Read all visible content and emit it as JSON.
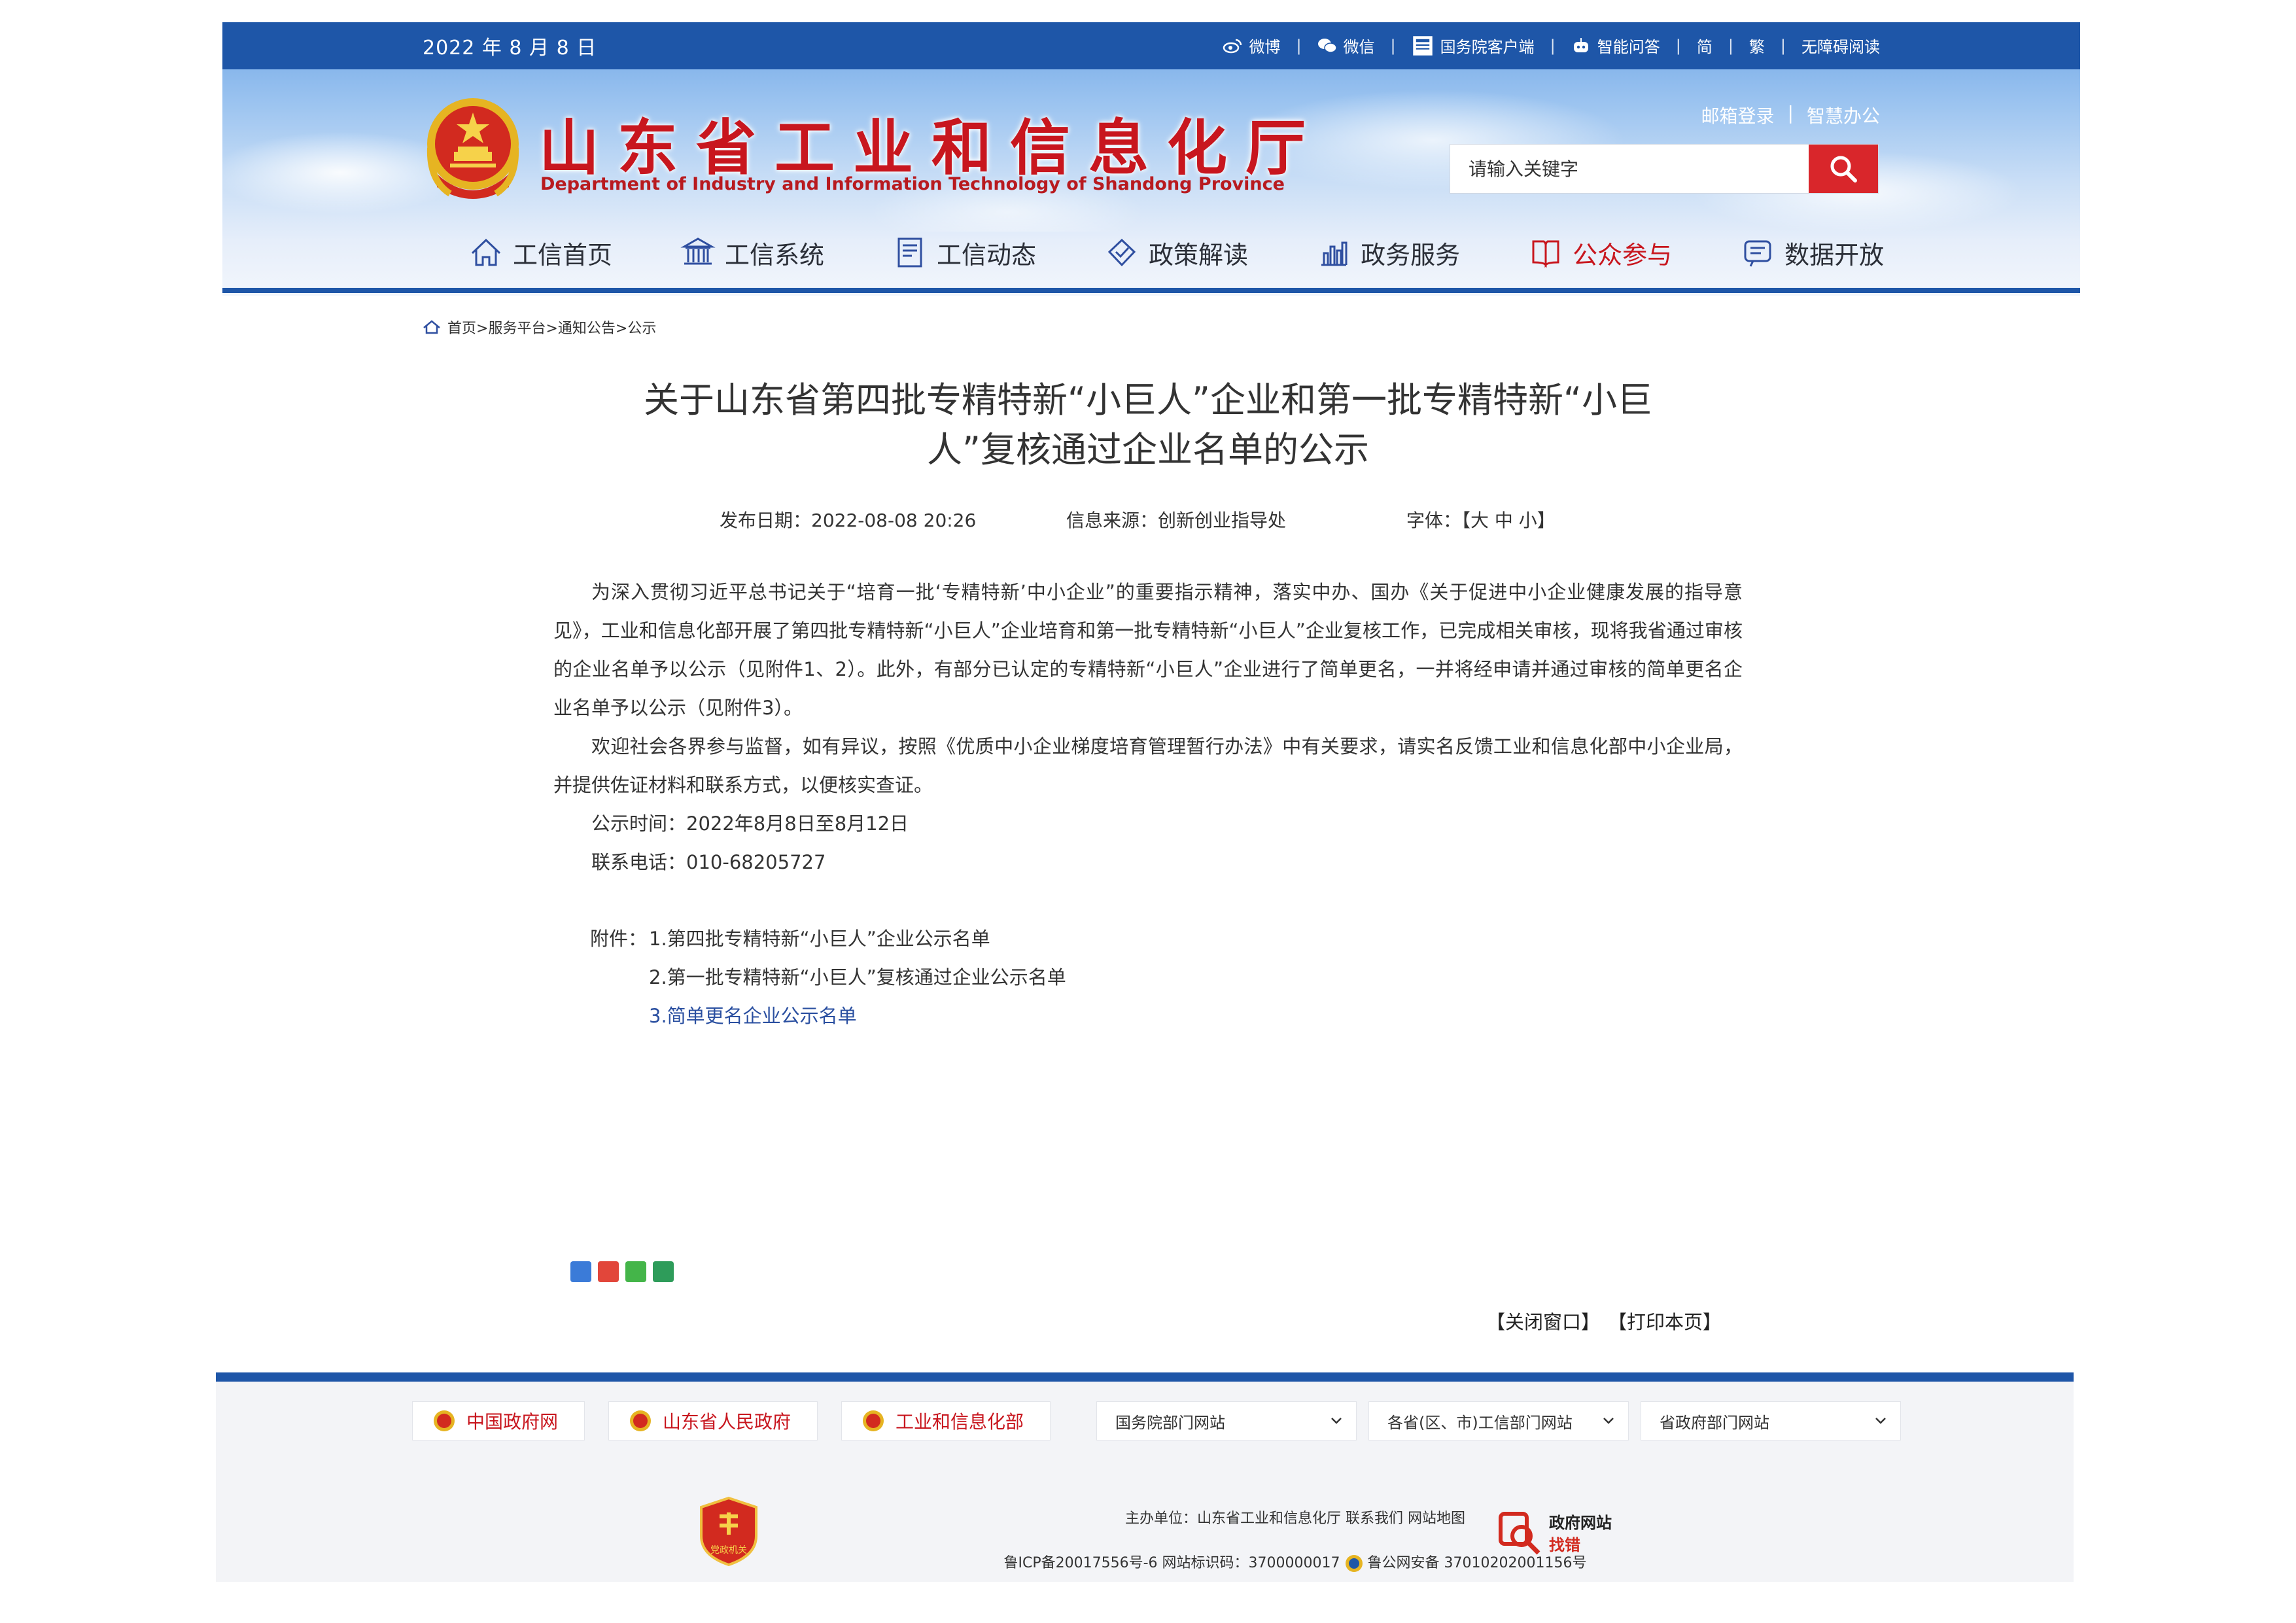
{
  "topbar": {
    "date": "2022 年 8 月 8 日",
    "links": [
      {
        "label": "微博",
        "icon": "weibo-icon"
      },
      {
        "label": "微信",
        "icon": "wechat-icon"
      },
      {
        "label": "国务院客户端",
        "icon": "mobile-app-icon"
      },
      {
        "label": "智能问答",
        "icon": "robot-icon"
      },
      {
        "label": "简",
        "icon": ""
      },
      {
        "label": "繁",
        "icon": ""
      },
      {
        "label": "无障碍阅读",
        "icon": ""
      }
    ]
  },
  "header": {
    "title": "山东省工业和信息化厅",
    "subtitle": "Department of Industry and Information Technology of Shandong Province",
    "links": [
      "邮箱登录",
      "智慧办公"
    ],
    "separator": "|",
    "search_placeholder": "请输入关键字"
  },
  "nav": {
    "items": [
      {
        "label": "工信首页",
        "icon": "home-icon",
        "active": false
      },
      {
        "label": "工信系统",
        "icon": "building-icon",
        "active": false
      },
      {
        "label": "工信动态",
        "icon": "news-icon",
        "active": false
      },
      {
        "label": "政策解读",
        "icon": "policy-icon",
        "active": false
      },
      {
        "label": "政务服务",
        "icon": "service-icon",
        "active": false
      },
      {
        "label": "公众参与",
        "icon": "book-icon",
        "active": true
      },
      {
        "label": "数据开放",
        "icon": "data-icon",
        "active": false
      }
    ]
  },
  "breadcrumb": {
    "items": [
      "首页",
      "服务平台",
      "通知公告",
      "公示"
    ],
    "sep": ">"
  },
  "article": {
    "title_line1": "关于山东省第四批专精特新“小巨人”企业和第一批专精特新“小巨",
    "title_line2": "人”复核通过企业名单的公示",
    "publish_date": "发布日期：2022-08-08 20:26",
    "source": "信息来源：创新创业指导处",
    "font_size_label": "字体：【大 中 小】",
    "paragraphs": [
      "为深入贯彻习近平总书记关于“培育一批‘专精特新’中小企业”的重要指示精神，落实中办、国办《关于促进中小企业健康发展的指导意见》，工业和信息化部开展了第四批专精特新“小巨人”企业培育和第一批专精特新“小巨人”企业复核工作，已完成相关审核，现将我省通过审核的企业名单予以公示（见附件1、2）。此外，有部分已认定的专精特新“小巨人”企业进行了简单更名，一并将经申请并通过审核的简单更名企业名单予以公示（见附件3）。",
      "欢迎社会各界参与监督，如有异议，按照《优质中小企业梯度培育管理暂行办法》中有关要求，请实名反馈工业和信息化部中小企业局，并提供佐证材料和联系方式，以便核实查证。",
      "公示时间：2022年8月8日至8月12日",
      "联系电话：010-68205727"
    ],
    "attachments_label": "附件：",
    "attachments": [
      "1.第四批专精特新“小巨人”企业公示名单",
      "2.第一批专精特新“小巨人”复核通过企业公示名单",
      "3.简单更名企业公示名单"
    ],
    "actions": [
      "【关闭窗口】",
      "【打印本页】"
    ]
  },
  "footer": {
    "links": [
      "中国政府网",
      "山东省人民政府",
      "工业和信息化部"
    ],
    "selects": [
      "国务院部门网站",
      "各省(区、市)工信部门网站",
      "省政府部门网站"
    ],
    "host": "主办单位：山东省工业和信息化厅  联系我们  网站地图",
    "icp": "鲁ICP备20017556号-6  网站标识码：3700000017",
    "police": "鲁公网安备 37010202001156号",
    "badge_text": "党政机关",
    "correction_line1": "政府网站",
    "correction_line2": "找错"
  },
  "colors": {
    "primary_blue": "#1e56a8",
    "brand_red": "#c8161e",
    "search_red": "#d9262b"
  }
}
